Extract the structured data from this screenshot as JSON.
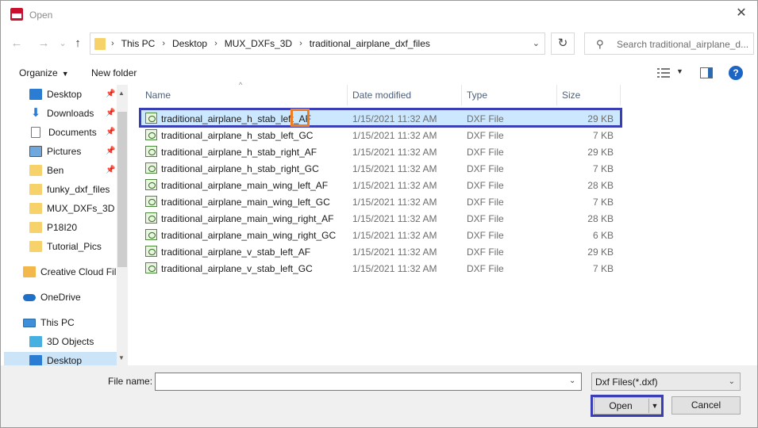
{
  "window": {
    "title": "Open",
    "close_glyph": "✕"
  },
  "nav": {
    "back_glyph": "←",
    "forward_glyph": "→",
    "recent_glyph": "⌄",
    "up_glyph": "↑",
    "breadcrumbs": [
      "This PC",
      "Desktop",
      "MUX_DXFs_3D",
      "traditional_airplane_dxf_files"
    ],
    "separator": "›",
    "dropdown_glyph": "⌄",
    "refresh_glyph": "↻",
    "search_placeholder": "Search traditional_airplane_d...",
    "search_glyph": "⚲"
  },
  "toolbar": {
    "organize_label": "Organize",
    "new_folder_label": "New folder",
    "dropdown_glyph": "▼",
    "help_glyph": "?"
  },
  "sidebar": {
    "items": [
      {
        "label": "Desktop",
        "icon": "desktop-icon",
        "pinned": true
      },
      {
        "label": "Downloads",
        "icon": "download-icon",
        "pinned": true
      },
      {
        "label": "Documents",
        "icon": "documents-icon",
        "pinned": true
      },
      {
        "label": "Pictures",
        "icon": "pictures-icon",
        "pinned": true
      },
      {
        "label": "Ben",
        "icon": "folder-icon",
        "pinned": true
      },
      {
        "label": "funky_dxf_files",
        "icon": "folder-icon",
        "pinned": false
      },
      {
        "label": "MUX_DXFs_3D",
        "icon": "folder-icon",
        "pinned": false
      },
      {
        "label": "P18I20",
        "icon": "folder-icon",
        "pinned": false
      },
      {
        "label": "Tutorial_Pics",
        "icon": "folder-icon",
        "pinned": false
      },
      {
        "label": "Creative Cloud Fil",
        "icon": "creative-cloud-icon",
        "pinned": false
      },
      {
        "label": "OneDrive",
        "icon": "onedrive-icon",
        "pinned": false
      },
      {
        "label": "This PC",
        "icon": "this-pc-icon",
        "pinned": false
      },
      {
        "label": "3D Objects",
        "icon": "3d-objects-icon",
        "pinned": false
      },
      {
        "label": "Desktop",
        "icon": "desktop-icon",
        "pinned": false,
        "selected": true
      }
    ],
    "pin_glyph": "📌",
    "scroll_up_glyph": "▲",
    "scroll_down_glyph": "▼"
  },
  "filelist": {
    "columns": {
      "name": "Name",
      "date": "Date modified",
      "type": "Type",
      "size": "Size"
    },
    "sort_glyph": "^",
    "rows": [
      {
        "name_prefix": "traditional_airplane_h_stab_left_",
        "name_suffix": "AF",
        "date": "1/15/2021 11:32 AM",
        "type": "DXF File",
        "size": "29 KB",
        "selected": true
      },
      {
        "name": "traditional_airplane_h_stab_left_GC",
        "date": "1/15/2021 11:32 AM",
        "type": "DXF File",
        "size": "7 KB"
      },
      {
        "name": "traditional_airplane_h_stab_right_AF",
        "date": "1/15/2021 11:32 AM",
        "type": "DXF File",
        "size": "29 KB"
      },
      {
        "name": "traditional_airplane_h_stab_right_GC",
        "date": "1/15/2021 11:32 AM",
        "type": "DXF File",
        "size": "7 KB"
      },
      {
        "name": "traditional_airplane_main_wing_left_AF",
        "date": "1/15/2021 11:32 AM",
        "type": "DXF File",
        "size": "28 KB"
      },
      {
        "name": "traditional_airplane_main_wing_left_GC",
        "date": "1/15/2021 11:32 AM",
        "type": "DXF File",
        "size": "7 KB"
      },
      {
        "name": "traditional_airplane_main_wing_right_AF",
        "date": "1/15/2021 11:32 AM",
        "type": "DXF File",
        "size": "28 KB"
      },
      {
        "name": "traditional_airplane_main_wing_right_GC",
        "date": "1/15/2021 11:32 AM",
        "type": "DXF File",
        "size": "6 KB"
      },
      {
        "name": "traditional_airplane_v_stab_left_AF",
        "date": "1/15/2021 11:32 AM",
        "type": "DXF File",
        "size": "29 KB"
      },
      {
        "name": "traditional_airplane_v_stab_left_GC",
        "date": "1/15/2021 11:32 AM",
        "type": "DXF File",
        "size": "7 KB"
      }
    ]
  },
  "footer": {
    "file_name_label": "File name:",
    "file_name_value": "",
    "filter_value": "Dxf Files(*.dxf)",
    "dropdown_glyph": "⌄",
    "open_label": "Open",
    "open_split_glyph": "▼",
    "cancel_label": "Cancel"
  },
  "colors": {
    "selection": "#cce8ff",
    "highlight_blue": "#3b3fb5",
    "highlight_orange": "#f07d1f",
    "help_blue": "#1c65c4"
  }
}
